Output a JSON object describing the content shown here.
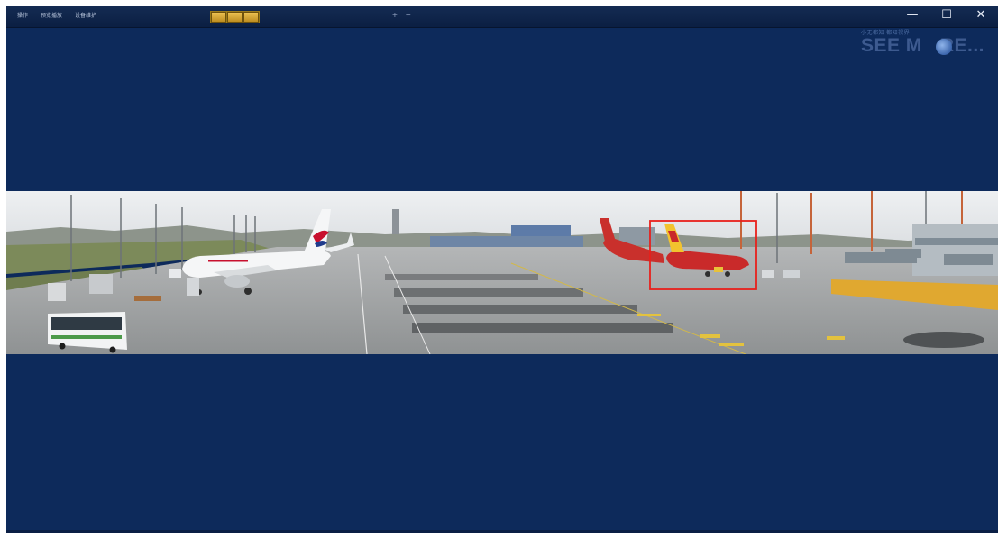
{
  "menu": {
    "items": [
      "操作",
      "预览播放",
      "设备维护"
    ]
  },
  "layout_switch": {
    "icon": "grid-layout-icon",
    "cells": 3
  },
  "zoom": {
    "plus": "+",
    "minus": "−"
  },
  "window_controls": {
    "minimize": "—",
    "maximize": "☐",
    "close": "✕"
  },
  "logo": {
    "tagline": "小无都知 都知视界",
    "text": "SEE M",
    "suffix": "RE..."
  },
  "video": {
    "content": "airport-apron-panorama",
    "detection_box_color": "#e8201c"
  },
  "colors": {
    "background": "#0d2a5b",
    "titlebar": "#0f254b",
    "accent_gold": "#e2b33c"
  }
}
